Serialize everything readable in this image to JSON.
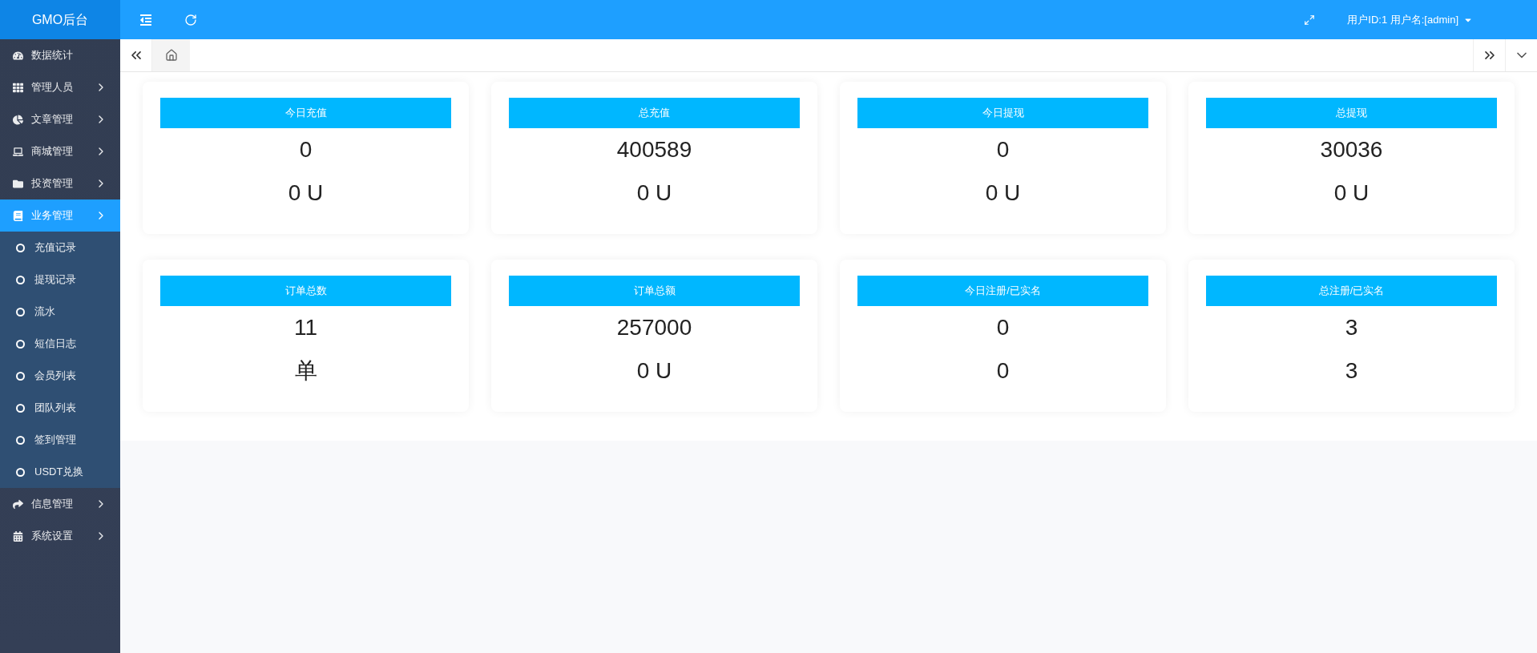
{
  "brand": "GMO后台",
  "user": "用户ID:1 用户名:[admin]",
  "sidebar": {
    "items": [
      {
        "label": "数据统计",
        "expandable": false,
        "selected": false
      },
      {
        "label": "管理人员",
        "expandable": true,
        "selected": false
      },
      {
        "label": "文章管理",
        "expandable": true,
        "selected": false
      },
      {
        "label": "商城管理",
        "expandable": true,
        "selected": false
      },
      {
        "label": "投资管理",
        "expandable": true,
        "selected": false
      },
      {
        "label": "业务管理",
        "expandable": true,
        "selected": true,
        "children": [
          {
            "label": "充值记录",
            "selected": false
          },
          {
            "label": "提现记录",
            "selected": false
          },
          {
            "label": "流水",
            "selected": false
          },
          {
            "label": "短信日志",
            "selected": false
          },
          {
            "label": "会员列表",
            "selected": false
          },
          {
            "label": "团队列表",
            "selected": false
          },
          {
            "label": "签到管理",
            "selected": false
          },
          {
            "label": "USDT兑换",
            "selected": false
          }
        ]
      },
      {
        "label": "信息管理",
        "expandable": true,
        "selected": false
      },
      {
        "label": "系统设置",
        "expandable": true,
        "selected": false
      }
    ]
  },
  "cards": [
    {
      "title": "今日充值",
      "value": "0",
      "sub": "0 U"
    },
    {
      "title": "总充值",
      "value": "400589",
      "sub": "0 U"
    },
    {
      "title": "今日提现",
      "value": "0",
      "sub": "0 U"
    },
    {
      "title": "总提现",
      "value": "30036",
      "sub": "0 U"
    },
    {
      "title": "订单总数",
      "value": "11",
      "sub": "单"
    },
    {
      "title": "订单总额",
      "value": "257000",
      "sub": "0 U"
    },
    {
      "title": "今日注册/已实名",
      "value": "0",
      "sub": "0"
    },
    {
      "title": "总注册/已实名",
      "value": "3",
      "sub": "3"
    }
  ]
}
